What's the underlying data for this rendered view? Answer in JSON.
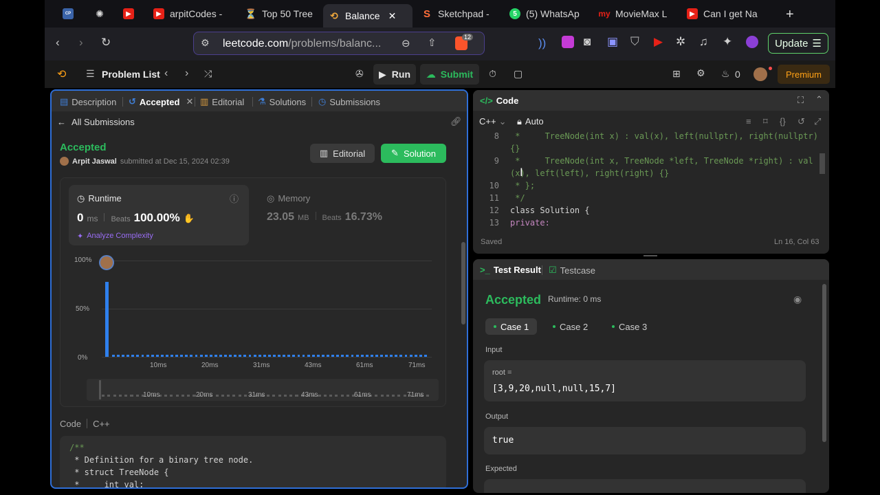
{
  "browser": {
    "tabs": [
      {
        "label": "",
        "icon": "comp-prog-icon"
      },
      {
        "label": "",
        "icon": "openai-icon"
      },
      {
        "label": "",
        "icon": "youtube-icon"
      },
      {
        "label": "arpitCodes -",
        "icon": "youtube-icon"
      },
      {
        "label": "Top 50 Tree",
        "icon": "hourglass-icon"
      },
      {
        "label": "Balance",
        "icon": "leetcode-icon"
      },
      {
        "label": "Sketchpad -",
        "icon": "sketchpad-icon"
      },
      {
        "label": "(5) WhatsAp",
        "icon": "whatsapp-icon"
      },
      {
        "label": "MovieMax L",
        "icon": "moviemax-icon"
      },
      {
        "label": "Can I get Na",
        "icon": "youtube-icon"
      }
    ],
    "new_tab": "+",
    "url_domain": "leetcode.com",
    "url_path": "/problems/balanc...",
    "brave_badge": "12",
    "update_label": "Update"
  },
  "lc_nav": {
    "problem_list": "Problem List",
    "run": "Run",
    "submit": "Submit",
    "streak": "0",
    "premium": "Premium"
  },
  "left_panel": {
    "tabs": [
      "Description",
      "Accepted",
      "Editorial",
      "Solutions",
      "Submissions"
    ],
    "back_label": "All Submissions",
    "status": "Accepted",
    "author": "Arpit Jaswal",
    "submitted_text": "submitted at Dec 15, 2024 02:39",
    "editorial_btn": "Editorial",
    "solution_btn": "Solution",
    "runtime": {
      "title": "Runtime",
      "value": "0",
      "unit": "ms",
      "beats_label": "Beats",
      "beats": "100.00%",
      "analyze": "Analyze Complexity"
    },
    "memory": {
      "title": "Memory",
      "value": "23.05",
      "unit": "MB",
      "beats_label": "Beats",
      "beats": "16.73%"
    },
    "code_label": "Code",
    "code_lang": "C++",
    "code_lines": [
      "/**",
      " * Definition for a binary tree node.",
      " * struct TreeNode {",
      " *     int val;"
    ]
  },
  "chart_data": {
    "type": "bar",
    "ylabels": [
      "100%",
      "50%",
      "0%"
    ],
    "xlabels": [
      "10ms",
      "20ms",
      "31ms",
      "43ms",
      "61ms",
      "71ms"
    ],
    "ylim": [
      0,
      100
    ],
    "highlight_value": 78,
    "baseline_bar_count": 65,
    "baseline_value": 1.5,
    "colors": {
      "bar": "#2f80ed",
      "grid": "#3a3a3a"
    }
  },
  "code_panel": {
    "title": "Code",
    "lang": "C++",
    "mode": "Auto",
    "lines": [
      {
        "n": "8",
        "text": " *     TreeNode(int x) : val(x), left(nullptr), right(nullptr)"
      },
      {
        "n": "",
        "text": "{}"
      },
      {
        "n": "9",
        "text": " *     TreeNode(int x, TreeNode *left, TreeNode *right) : val"
      },
      {
        "n": "",
        "text": "(x), left(left), right(right) {}"
      },
      {
        "n": "10",
        "text": " * };"
      },
      {
        "n": "11",
        "text": " */"
      },
      {
        "n": "12",
        "text": "class Solution {"
      },
      {
        "n": "13",
        "text": "private:"
      }
    ],
    "saved": "Saved",
    "cursor_pos": "Ln 16, Col 63"
  },
  "result_panel": {
    "tab_result": "Test Result",
    "tab_testcase": "Testcase",
    "status": "Accepted",
    "runtime": "Runtime: 0 ms",
    "cases": [
      "Case 1",
      "Case 2",
      "Case 3"
    ],
    "input_label": "Input",
    "input_var": "root =",
    "input_value": "[3,9,20,null,null,15,7]",
    "output_label": "Output",
    "output_value": "true",
    "expected_label": "Expected"
  }
}
